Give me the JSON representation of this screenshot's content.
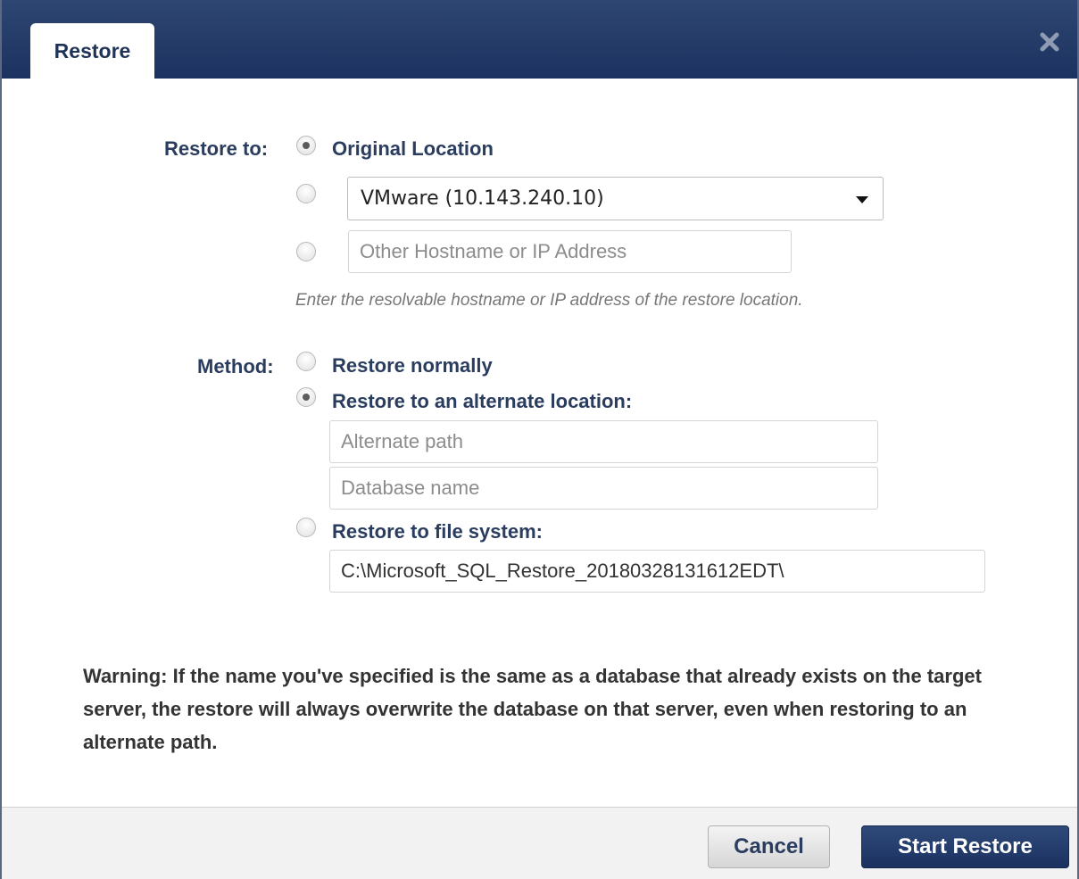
{
  "dialog": {
    "tab_label": "Restore",
    "close_icon": "close-icon"
  },
  "restore_to": {
    "label": "Restore to:",
    "original_label": "Original Location",
    "selected": "original",
    "server_select_value": "VMware (10.143.240.10)",
    "other_host_placeholder": "Other Hostname or IP Address",
    "hint": "Enter the resolvable hostname or IP address of the restore location."
  },
  "method": {
    "label": "Method:",
    "normal_label": "Restore normally",
    "alternate_label": "Restore to an alternate location:",
    "alternate_path_placeholder": "Alternate path",
    "database_name_placeholder": "Database name",
    "filesystem_label": "Restore to file system:",
    "filesystem_path_value": "C:\\Microsoft_SQL_Restore_20180328131612EDT\\",
    "selected": "alternate"
  },
  "warning": "Warning: If the name you've specified is the same as a database that already exists on the target server, the restore will always overwrite the database on that server, even when restoring to an alternate path.",
  "footer": {
    "cancel_label": "Cancel",
    "start_label": "Start Restore"
  }
}
